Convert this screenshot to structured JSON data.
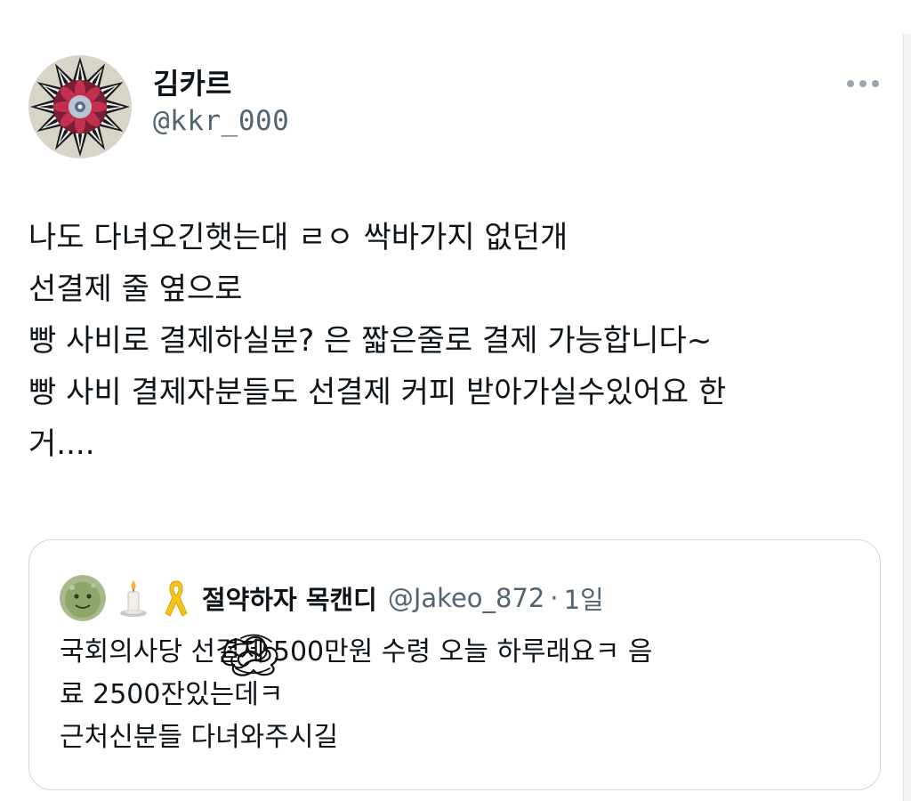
{
  "tweet": {
    "author": {
      "display_name": "김카르",
      "handle": "@kkr_000",
      "avatar_icon": "kaleidoscope-avatar"
    },
    "more_icon": "more-horizontal-icon",
    "text": "나도 다녀오긴햇는대 ㄹㅇ 싹바가지 없던개\n선결제 줄 옆으로\n빵 사비로 결제하실분? 은 짧은줄로 결제 가능합니다~\n빵 사비 결제자분들도 선결제 커피 받아가실수있어요 한\n거...."
  },
  "quote": {
    "author": {
      "emojis": [
        "candle-icon",
        "yellow-ribbon-icon"
      ],
      "display_name": "절약하자 목캔디",
      "handle": "@Jakeo_872",
      "separator": "·",
      "time": "1일",
      "avatar_icon": "green-character-avatar"
    },
    "text": "국회의사당       선결제 500만원 수령 오늘 하루래요ㅋ 음\n료 2500잔있는데ㅋ\n근처신분들 다녀와주시길",
    "redaction_icon": "scribble-redaction"
  },
  "colors": {
    "text_primary": "#0f1419",
    "text_secondary": "#536471",
    "border": "#cfd9de"
  }
}
